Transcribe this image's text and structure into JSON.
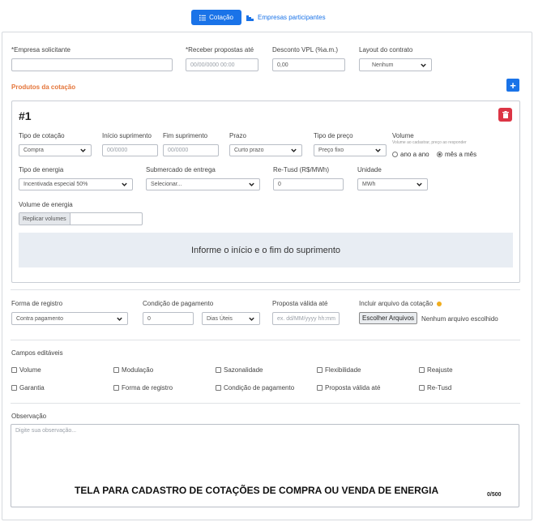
{
  "tabs": {
    "active": "Cotação",
    "other": "Empresas participantes"
  },
  "header_fields": {
    "empresa_label": "*Empresa solicitante",
    "receber_label": "*Receber propostas até",
    "receber_placeholder": "00/00/0000 00:00",
    "desconto_label": "Desconto VPL (%a.m.)",
    "desconto_value": "0,00",
    "layout_label": "Layout do contrato",
    "layout_value": "Nenhum"
  },
  "produtos": {
    "title": "Produtos da cotação",
    "item_number": "#1",
    "tipo_cotacao_label": "Tipo de cotação",
    "tipo_cotacao_value": "Compra",
    "inicio_label": "Início suprimento",
    "inicio_placeholder": "00/0000",
    "fim_label": "Fim suprimento",
    "fim_placeholder": "00/0000",
    "prazo_label": "Prazo",
    "prazo_value": "Curto prazo",
    "tipo_preco_label": "Tipo de preço",
    "tipo_preco_value": "Preço fixo",
    "volume_label": "Volume",
    "volume_hint": "Volume ao cadastrar, preço ao responder",
    "volume_opt1": "ano a ano",
    "volume_opt2": "mês a mês",
    "tipo_energia_label": "Tipo de energia",
    "tipo_energia_value": "Incentivada especial 50%",
    "submercado_label": "Submercado de entrega",
    "submercado_value": "Selecionar...",
    "retusd_label": "Re-Tusd (R$/MWh)",
    "retusd_value": "0",
    "unidade_label": "Unidade",
    "unidade_value": "MWh",
    "volume_energia_label": "Volume de energia",
    "replicar_label": "Replicar volumes",
    "info_message": "Informe o início e o fim do suprimento"
  },
  "registro": {
    "forma_label": "Forma de registro",
    "forma_value": "Contra pagamento",
    "condicao_label": "Condição de pagamento",
    "condicao_value": "0",
    "condicao_unit": "Dias Úteis",
    "validade_label": "Proposta válida até",
    "validade_placeholder": "ex. dd/MM/yyyy hh:mm",
    "arquivo_label": "Incluir arquivo da cotação",
    "arquivo_button": "Escolher Arquivos",
    "arquivo_status": "Nenhum arquivo escolhido"
  },
  "campos": {
    "title": "Campos editáveis",
    "items": [
      "Volume",
      "Modulação",
      "Sazonalidade",
      "Flexibilidade",
      "Reajuste",
      "Garantia",
      "Forma de registro",
      "Condição de pagamento",
      "Proposta válida até",
      "Re-Tusd"
    ]
  },
  "observacao": {
    "label": "Observação",
    "placeholder": "Digite sua observação...",
    "counter": "0/500"
  },
  "caption": "TELA PARA CADASTRO DE COTAÇÕES DE COMPRA OU VENDA DE ENERGIA",
  "colors": {
    "primary": "#1a73e8",
    "accent": "#e4753a",
    "danger": "#dc3545",
    "info_bg": "#e8edf3"
  }
}
